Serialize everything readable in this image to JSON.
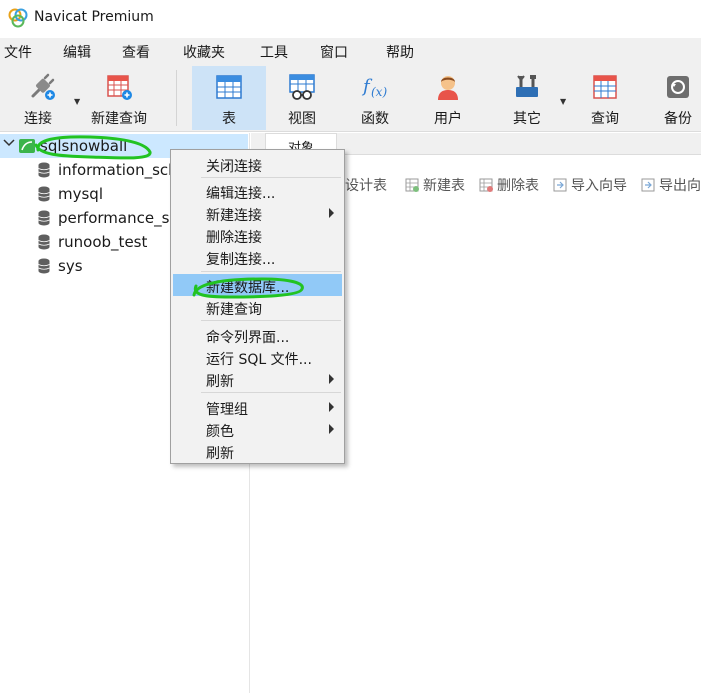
{
  "window": {
    "title": "Navicat Premium"
  },
  "menubar": {
    "items": [
      "文件",
      "编辑",
      "查看",
      "收藏夹",
      "工具",
      "窗口",
      "帮助"
    ]
  },
  "toolbar": {
    "connect_label": "连接",
    "new_query_label": "新建查询",
    "table_label": "表",
    "view_label": "视图",
    "function_label": "函数",
    "user_label": "用户",
    "other_label": "其它",
    "query_label": "查询",
    "backup_label": "备份"
  },
  "tree": {
    "connection": "sqlsnowball",
    "databases": [
      "information_sch",
      "mysql",
      "performance_sc",
      "runoob_test",
      "sys"
    ]
  },
  "tabs": {
    "objects_label": "对象"
  },
  "object_toolbar": {
    "design_table": "设计表",
    "new_table": "新建表",
    "delete_table": "删除表",
    "import_wizard": "导入向导",
    "export_wizard": "导出向"
  },
  "context_menu": {
    "close_connection": "关闭连接",
    "edit_connection": "编辑连接...",
    "new_connection": "新建连接",
    "delete_connection": "删除连接",
    "copy_connection": "复制连接...",
    "new_database": "新建数据库...",
    "new_query": "新建查询",
    "command_line": "命令列界面...",
    "run_sql_file": "运行 SQL 文件...",
    "refresh_sub": "刷新",
    "manage_group": "管理组",
    "color": "颜色",
    "refresh": "刷新"
  },
  "colors": {
    "selection": "#cce8ff",
    "menu_highlight": "#91c9f7",
    "annotation": "#22c322"
  }
}
